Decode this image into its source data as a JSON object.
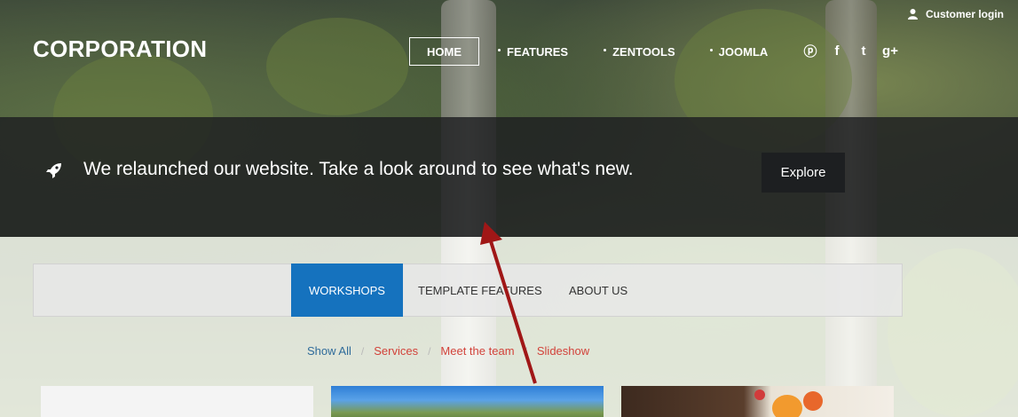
{
  "header": {
    "logo": "CORPORATION",
    "login_label": "Customer login",
    "nav": [
      {
        "label": "HOME"
      },
      {
        "label": "FEATURES"
      },
      {
        "label": "ZENTOOLS"
      },
      {
        "label": "JOOMLA"
      }
    ],
    "social_icons": [
      "pinterest-icon",
      "facebook-icon",
      "twitter-icon",
      "google-plus-icon"
    ],
    "social_glyphs": [
      "ⓟ",
      "f",
      "t",
      "g+"
    ]
  },
  "banner": {
    "message": "We relaunched our website. Take a look around to see what's new.",
    "button_label": "Explore",
    "icon": "rocket-icon"
  },
  "tabs": [
    {
      "label": "WORKSHOPS"
    },
    {
      "label": "TEMPLATE FEATURES"
    },
    {
      "label": "ABOUT US"
    }
  ],
  "filters": [
    "Show All",
    "Services",
    "Meet the team",
    "Slideshow"
  ],
  "filter_separator": "/",
  "colors": {
    "accent": "#1572be",
    "filter_red": "#d2423a",
    "annotation_arrow": "#a01717"
  }
}
